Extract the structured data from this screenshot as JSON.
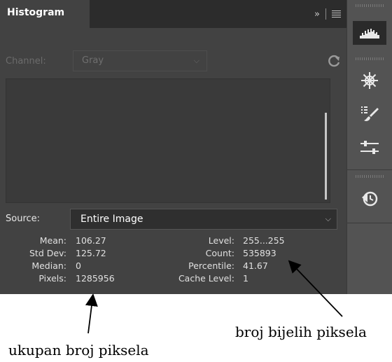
{
  "panel": {
    "tab_title": "Histogram",
    "collapse_glyph": "»",
    "channel": {
      "label": "Channel:",
      "value": "Gray"
    },
    "source": {
      "label": "Source:",
      "value": "Entire Image"
    },
    "stats_left": [
      {
        "label": "Mean:",
        "value": "106.27"
      },
      {
        "label": "Std Dev:",
        "value": "125.72"
      },
      {
        "label": "Median:",
        "value": "0"
      },
      {
        "label": "Pixels:",
        "value": "1285956"
      }
    ],
    "stats_right": [
      {
        "label": "Level:",
        "value": "255...255"
      },
      {
        "label": "Count:",
        "value": "535893"
      },
      {
        "label": "Percentile:",
        "value": "41.67"
      },
      {
        "label": "Cache Level:",
        "value": "1"
      }
    ]
  },
  "toolstrip": {
    "icons": [
      "histogram-icon",
      "navigator-icon",
      "brush-presets-icon",
      "properties-icon",
      "history-icon"
    ]
  },
  "annotations": {
    "left": "ukupan broj piksela",
    "right": "broj bijelih piksela"
  },
  "colors": {
    "panel_bg": "#424242",
    "tabbar_bg": "#2c2c2c",
    "toolstrip_bg": "#535353"
  }
}
